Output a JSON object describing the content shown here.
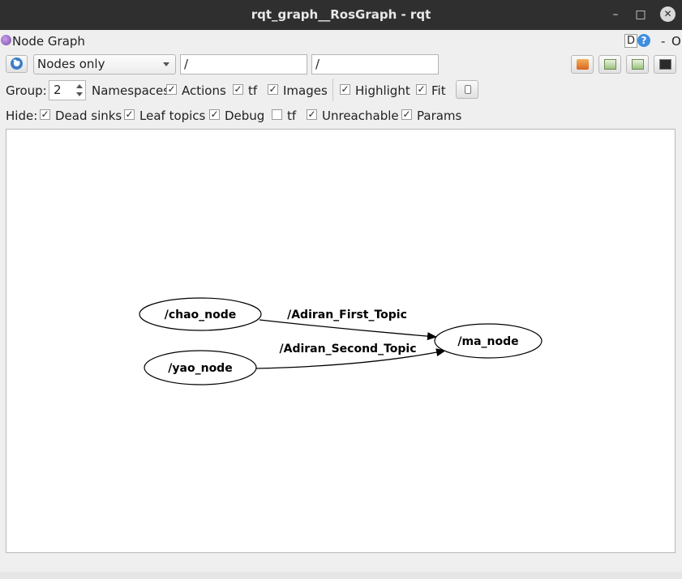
{
  "window": {
    "title": "rqt_graph__RosGraph - rqt",
    "minimize": "–",
    "maximize": "□",
    "close": "✕"
  },
  "plugin": {
    "title": "Node Graph",
    "d_label": "D",
    "help_label": "?",
    "dash_label": "-",
    "o_label": "O"
  },
  "toolbar": {
    "mode_select": "Nodes only",
    "node_filter": "/",
    "topic_filter": "/"
  },
  "options": {
    "group_label": "Group:",
    "group_value": "2",
    "namespaces": "Namespaces",
    "actions": "Actions",
    "tf": "tf",
    "images": "Images",
    "highlight": "Highlight",
    "fit": "Fit",
    "check": "✓"
  },
  "hide": {
    "label": "Hide:",
    "dead_sinks": "Dead sinks",
    "leaf_topics": "Leaf topics",
    "debug": "Debug",
    "tf": "tf",
    "unreachable": "Unreachable",
    "params": "Params"
  },
  "graph": {
    "nodes": [
      "/chao_node",
      "/yao_node",
      "/ma_node"
    ],
    "edges": [
      {
        "from": "/chao_node",
        "to": "/ma_node",
        "label": "/Adiran_First_Topic"
      },
      {
        "from": "/yao_node",
        "to": "/ma_node",
        "label": "/Adiran_Second_Topic"
      }
    ]
  }
}
